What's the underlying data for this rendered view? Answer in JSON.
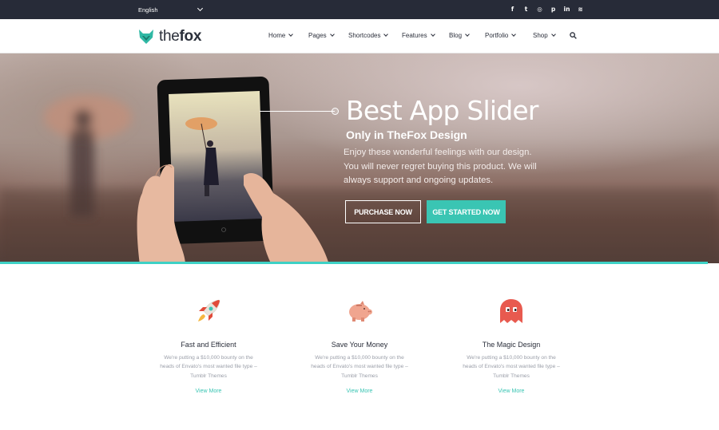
{
  "topbar": {
    "language": "English",
    "socials": [
      {
        "icon": "facebook-icon",
        "glyph": "f"
      },
      {
        "icon": "twitter-icon",
        "glyph": "t"
      },
      {
        "icon": "dribbble-icon",
        "glyph": "◎"
      },
      {
        "icon": "pinterest-icon",
        "glyph": "p"
      },
      {
        "icon": "linkedin-icon",
        "glyph": "in"
      },
      {
        "icon": "rss-icon",
        "glyph": "≋"
      }
    ]
  },
  "header": {
    "logo_light": "the",
    "logo_bold": "fox",
    "nav": [
      "Home",
      "Pages",
      "Shortcodes",
      "Features",
      "Blog",
      "Portfolio",
      "Shop"
    ]
  },
  "hero": {
    "title": "Best App Slider",
    "subtitle": "Only in TheFox Design",
    "body": "Enjoy these wonderful feelings with our design. You will never regret buying this product. We will always support and ongoing updates.",
    "purchase_label": "PURCHASE NOW",
    "start_label": "GET STARTED NOW",
    "accent_color": "#3ac5b3"
  },
  "features": [
    {
      "title": "Fast and Efficient",
      "desc": "We're putting a $10,000 bounty on the heads of Envato's most wanted file type – Tumblr Themes",
      "link": "View More",
      "icon": "rocket-icon"
    },
    {
      "title": "Save Your Money",
      "desc": "We're putting a $10,000 bounty on the heads of Envato's most wanted file type – Tumblr Themes",
      "link": "View More",
      "icon": "piggy-bank-icon"
    },
    {
      "title": "The Magic Design",
      "desc": "We're putting a $10,000 bounty on the heads of Envato's most wanted file type – Tumblr Themes",
      "link": "View More",
      "icon": "ghost-icon"
    }
  ]
}
